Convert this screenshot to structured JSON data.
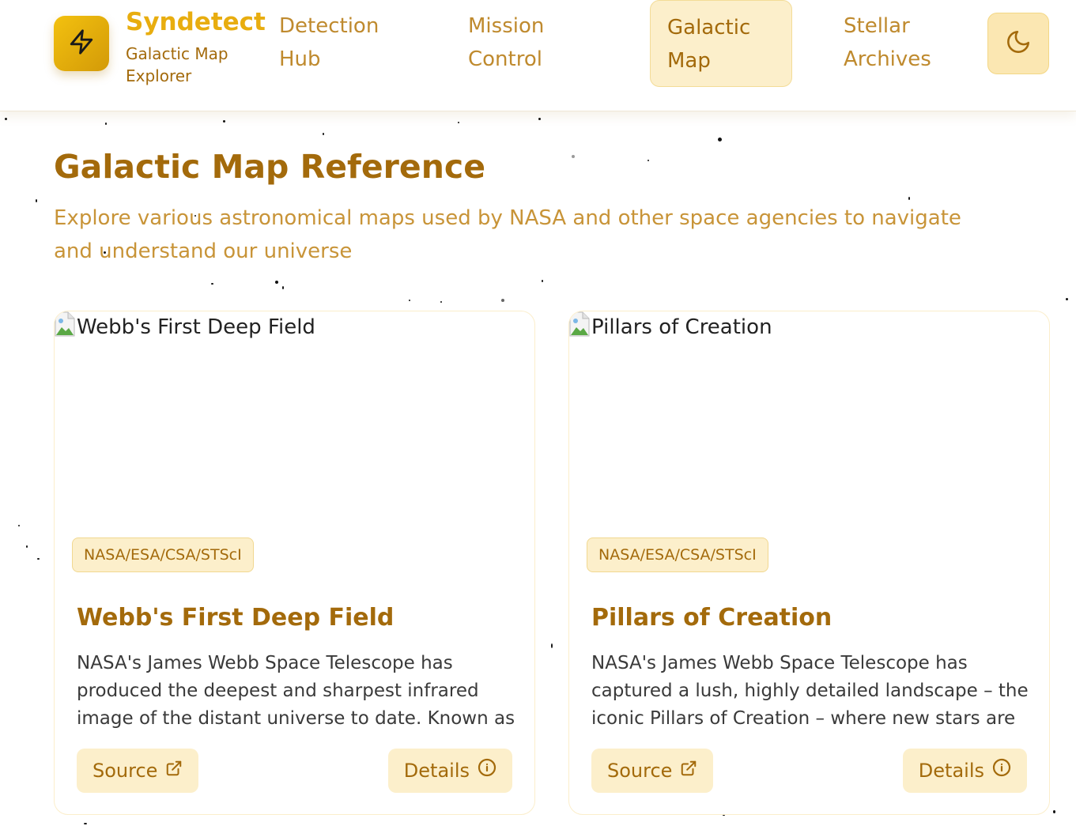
{
  "header": {
    "brand_name": "Syndetect",
    "brand_subtitle": "Galactic Map Explorer",
    "logo_icon": "lightning-bolt-icon",
    "theme_toggle_icon": "moon-icon",
    "nav": [
      {
        "label": "Detection Hub",
        "active": false
      },
      {
        "label": "Mission Control",
        "active": false
      },
      {
        "label": "Galactic Map",
        "active": true
      },
      {
        "label": "Stellar Archives",
        "active": false
      }
    ]
  },
  "main": {
    "title": "Galactic Map Reference",
    "description": "Explore various astronomical maps used by NASA and other space agencies to navigate and understand our universe",
    "cards": [
      {
        "image_alt": "Webb's First Deep Field",
        "credit": "NASA/ESA/CSA/STScI",
        "title": "Webb's First Deep Field",
        "description": "NASA's James Webb Space Telescope has produced the deepest and sharpest infrared image of the distant universe to date. Known as Webb's…",
        "source_label": "Source",
        "details_label": "Details"
      },
      {
        "image_alt": "Pillars of Creation",
        "credit": "NASA/ESA/CSA/STScI",
        "title": "Pillars of Creation",
        "description": "NASA's James Webb Space Telescope has captured a lush, highly detailed landscape – the iconic Pillars of Creation – where new stars are forming within…",
        "source_label": "Source",
        "details_label": "Details"
      }
    ]
  },
  "colors": {
    "brand": "#e8ad0f",
    "accent_dark": "#a36a0b",
    "accent_light": "#fcefcb",
    "nav_text": "#bf8a2e"
  }
}
